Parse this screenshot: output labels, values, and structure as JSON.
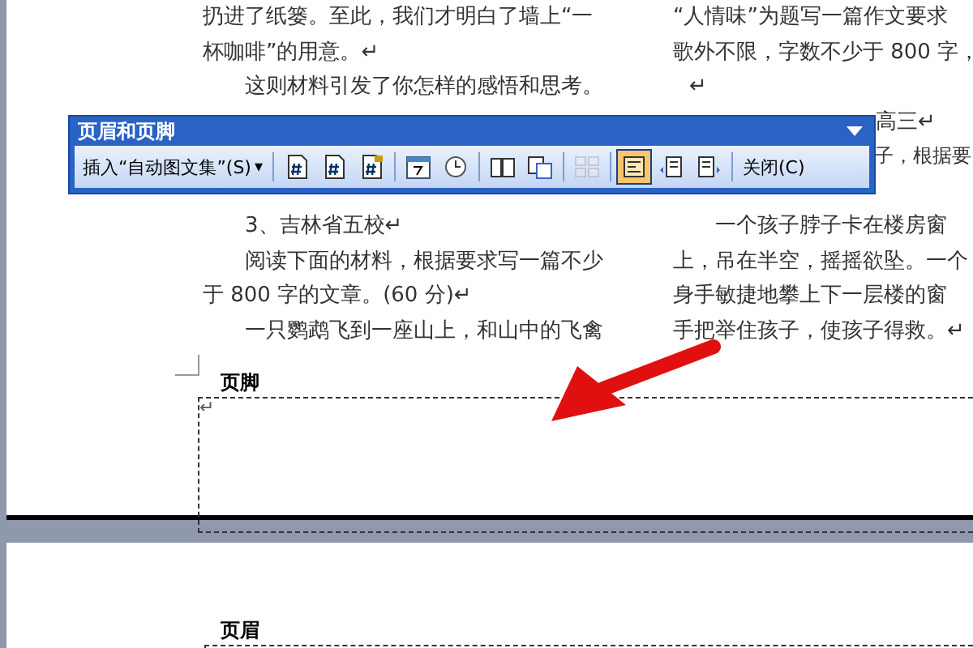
{
  "document": {
    "left_top": [
      {
        "text": "扔进了纸篓。至此，我们才明白了墙上“一",
        "indent": false
      },
      {
        "text": "杯咖啡”的用意。↵",
        "indent": false
      },
      {
        "text": "这则材料引发了你怎样的感悟和思考。",
        "indent": true
      }
    ],
    "left_bottom": [
      {
        "text": "3、吉林省五校↵",
        "indent": true
      },
      {
        "text": "阅读下面的材料，根据要求写一篇不少",
        "indent": true
      },
      {
        "text": "于 800 字的文章。(60 分)↵",
        "indent": false
      },
      {
        "text": "一只鹦鹉飞到一座山上，和山中的飞禽",
        "indent": true
      }
    ],
    "right_top": [
      {
        "text": "“人情味”为题写一篇作文要求",
        "indent": false
      },
      {
        "text": "歌外不限，字数不少于 800 字，",
        "indent": false
      },
      {
        "text": "↵",
        "indent": true
      }
    ],
    "right_fragments": [
      "高三↵",
      "子，根据要"
    ],
    "right_bottom": [
      {
        "text": "一个孩子脖子卡在楼房窗",
        "indent": true
      },
      {
        "text": "上，吊在半空，摇摇欲坠。一个",
        "indent": false
      },
      {
        "text": "身手敏捷地攀上下一层楼的窗",
        "indent": false
      },
      {
        "text": "手把举住孩子，使孩子得救。↵",
        "indent": false
      }
    ],
    "footer_label": "页脚",
    "footer_mark": "↵",
    "header_label": "页眉"
  },
  "toolbar": {
    "title": "页眉和页脚",
    "buttons": [
      {
        "kind": "text",
        "label": "插入“自动图文集”(S)",
        "caret": "▾",
        "selected": false,
        "disabled": false
      },
      {
        "kind": "separator"
      },
      {
        "kind": "icon",
        "selected": false,
        "disabled": false
      },
      {
        "kind": "icon",
        "selected": false,
        "disabled": false
      },
      {
        "kind": "icon",
        "selected": false,
        "disabled": false
      },
      {
        "kind": "separator"
      },
      {
        "kind": "icon",
        "selected": false,
        "disabled": false
      },
      {
        "kind": "icon",
        "selected": false,
        "disabled": false
      },
      {
        "kind": "separator"
      },
      {
        "kind": "icon",
        "selected": false,
        "disabled": false
      },
      {
        "kind": "icon",
        "selected": false,
        "disabled": false
      },
      {
        "kind": "separator"
      },
      {
        "kind": "icon",
        "selected": false,
        "disabled": true
      },
      {
        "kind": "separator"
      },
      {
        "kind": "icon",
        "selected": true,
        "disabled": false
      },
      {
        "kind": "icon",
        "selected": false,
        "disabled": false
      },
      {
        "kind": "icon",
        "selected": false,
        "disabled": false
      },
      {
        "kind": "separator"
      },
      {
        "kind": "text",
        "label": "关闭(C)",
        "selected": false,
        "disabled": false
      }
    ]
  }
}
